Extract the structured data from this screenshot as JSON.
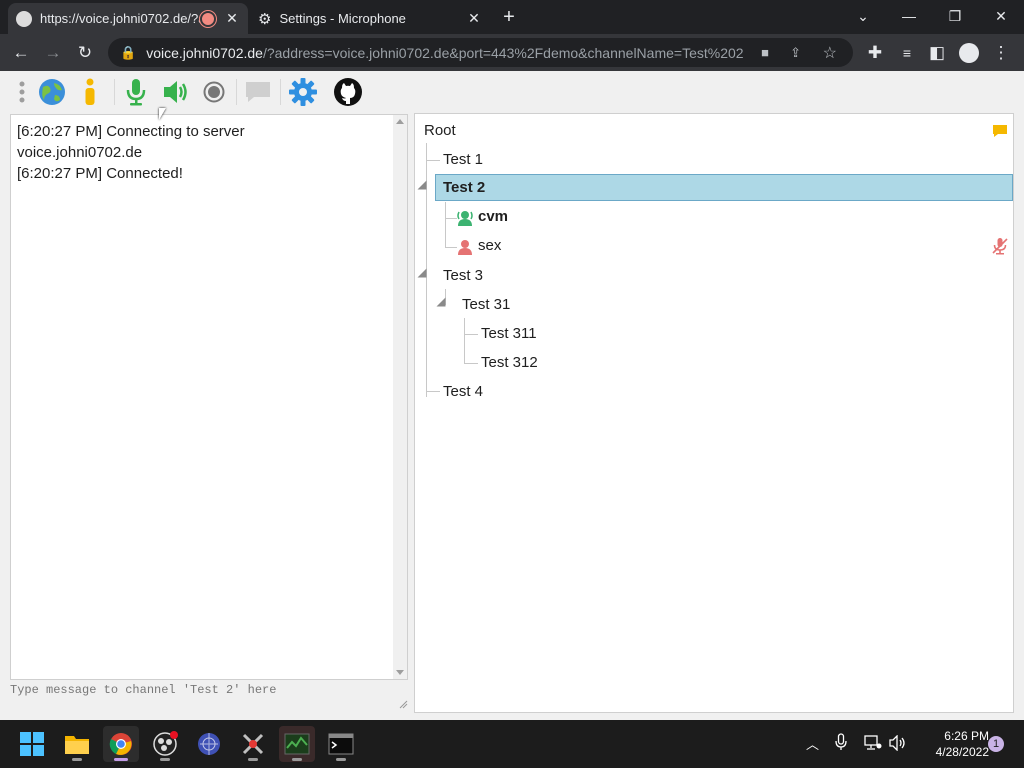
{
  "browser": {
    "tabs": [
      {
        "title": "https://voice.johni0702.de/?a",
        "active": true
      },
      {
        "title": "Settings - Microphone",
        "active": false
      }
    ],
    "new_tab_symbol": "+",
    "url_host": "voice.johni0702.de",
    "url_rest": "/?address=voice.johni0702.de&port=443%2Fdemo&channelName=Test%202"
  },
  "app_toolbar": {
    "icons": [
      "drag-handle-icon",
      "connect-globe-icon",
      "info-icon",
      "microphone-icon",
      "speaker-icon",
      "record-icon",
      "chat-bubble-icon",
      "settings-gear-icon",
      "github-icon"
    ]
  },
  "chat": {
    "lines": [
      "[6:20:27 PM] Connecting to server",
      "voice.johni0702.de",
      "[6:20:27 PM] Connected!"
    ],
    "input_placeholder": "Type message to channel 'Test 2' here"
  },
  "tree": {
    "root": "Root",
    "channels": {
      "test1": "Test 1",
      "test2": "Test 2",
      "test3": "Test 3",
      "test31": "Test 31",
      "test311": "Test 311",
      "test312": "Test 312",
      "test4": "Test 4"
    },
    "users": {
      "cvm": "cvm",
      "sex": "sex"
    },
    "colors": {
      "selection": "#add8e6",
      "talking_user": "#3cb371",
      "muted_user": "#e57373",
      "comment": "#f5b800"
    }
  },
  "taskbar": {
    "apps": [
      "windows-start-icon",
      "file-explorer-icon",
      "chrome-icon",
      "obs-icon",
      "app-globe-icon",
      "app-tools-icon",
      "task-manager-icon",
      "terminal-icon"
    ],
    "time": "6:26 PM",
    "date": "4/28/2022",
    "notification_count": "1"
  }
}
